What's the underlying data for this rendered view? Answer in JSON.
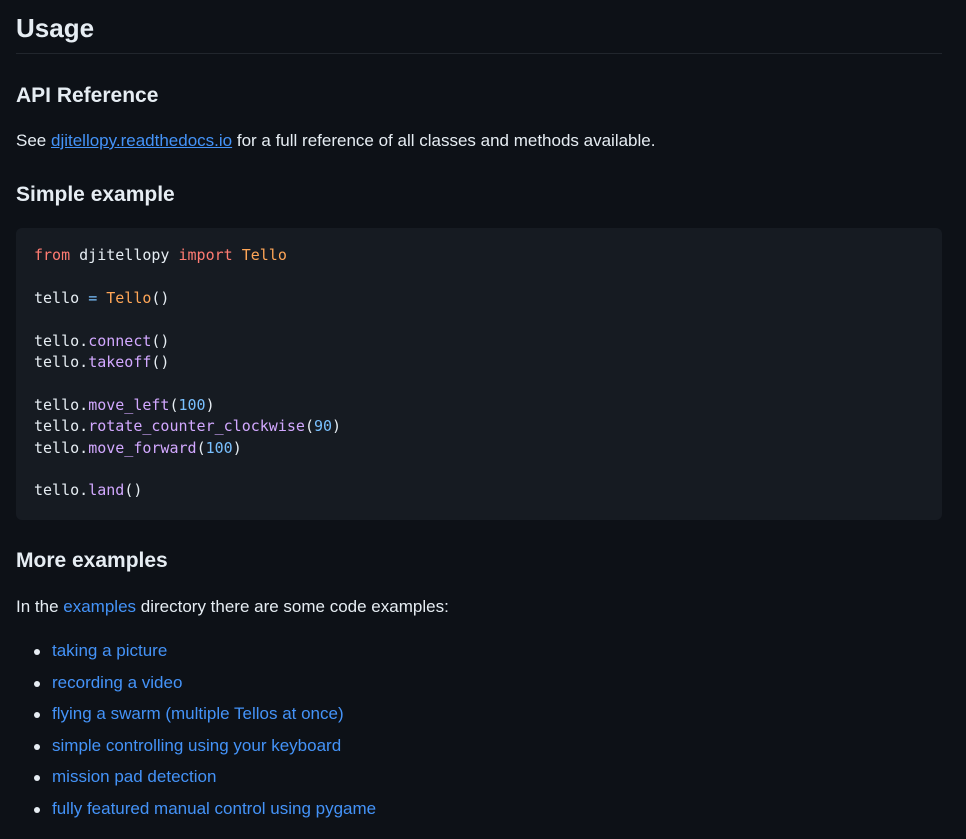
{
  "usage": {
    "title": "Usage"
  },
  "api_reference": {
    "title": "API Reference",
    "text_before": "See ",
    "link_label": "djitellopy.readthedocs.io",
    "text_after": " for a full reference of all classes and methods available."
  },
  "simple_example": {
    "title": "Simple example",
    "code": {
      "l1_kw_from": "from",
      "l1_mod": " djitellopy ",
      "l1_kw_import": "import",
      "l1_cls": " Tello",
      "l3_var": "tello ",
      "l3_eq": "=",
      "l3_cls": " Tello",
      "l3_paren": "()",
      "l5_obj": "tello.",
      "l5_fn": "connect",
      "l5_paren": "()",
      "l6_obj": "tello.",
      "l6_fn": "takeoff",
      "l6_paren": "()",
      "l8_obj": "tello.",
      "l8_fn": "move_left",
      "l8_open": "(",
      "l8_num": "100",
      "l8_close": ")",
      "l9_obj": "tello.",
      "l9_fn": "rotate_counter_clockwise",
      "l9_open": "(",
      "l9_num": "90",
      "l9_close": ")",
      "l10_obj": "tello.",
      "l10_fn": "move_forward",
      "l10_open": "(",
      "l10_num": "100",
      "l10_close": ")",
      "l12_obj": "tello.",
      "l12_fn": "land",
      "l12_paren": "()"
    }
  },
  "more_examples": {
    "title": "More examples",
    "text_before": "In the ",
    "link_label": "examples",
    "text_after": " directory there are some code examples:",
    "items": [
      "taking a picture",
      "recording a video",
      "flying a swarm (multiple Tellos at once)",
      "simple controlling using your keyboard",
      "mission pad detection",
      "fully featured manual control using pygame"
    ]
  },
  "colors": {
    "background": "#0d1117",
    "code_background": "#161b22",
    "text": "#e6edf3",
    "link": "#4493f8",
    "keyword": "#ff7b72",
    "class_name": "#ffa657",
    "function_name": "#d2a8ff",
    "number": "#79c0ff"
  }
}
